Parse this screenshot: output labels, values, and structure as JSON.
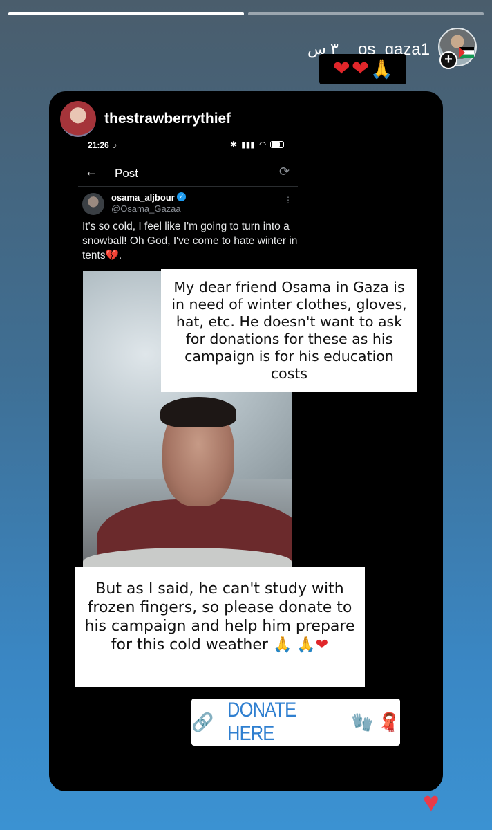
{
  "story": {
    "progress": [
      1.0,
      0.0
    ],
    "username": "os_gaza1",
    "time_ago": "٣ س",
    "emoji_sticker": {
      "icons": [
        "heart",
        "heart",
        "folded-hands"
      ]
    }
  },
  "card": {
    "username": "thestrawberrythief",
    "phone_status": {
      "time": "21:26"
    },
    "post_header": {
      "title": "Post"
    },
    "tweet": {
      "name": "osama_aljbour",
      "handle": "@Osama_Gazaa",
      "text": "It's so cold, I feel like I'm going to turn into a snowball! Oh God, I've come to hate winter in tents💔."
    },
    "sticker_1": "My dear friend Osama in Gaza is in need of winter clothes, gloves, hat, etc. He doesn't want to ask for donations for these as his campaign is for his education costs",
    "sticker_2_text": "But as I said, he can't study with frozen fingers, so please donate to his campaign and help him prepare for this cold weather",
    "donate": {
      "label": "DONATE HERE"
    }
  },
  "colors": {
    "accent": "#2f7fd0",
    "like": "#ea3b4a",
    "verified": "#1d9bf0"
  }
}
